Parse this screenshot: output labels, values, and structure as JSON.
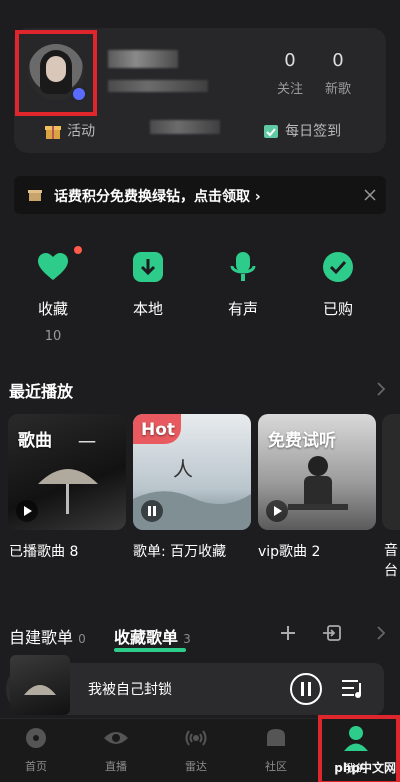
{
  "profile": {
    "stats": [
      {
        "value": "0",
        "label": "关注"
      },
      {
        "value": "0",
        "label": "新歌"
      }
    ],
    "activity_label": "活动",
    "checkin_label": "每日签到"
  },
  "banner": {
    "text": "话费积分免费换绿钻，点击领取 ›"
  },
  "quick_actions": [
    {
      "label": "收藏",
      "count": "10"
    },
    {
      "label": "本地",
      "count": ""
    },
    {
      "label": "有声",
      "count": ""
    },
    {
      "label": "已购",
      "count": ""
    }
  ],
  "recent": {
    "title": "最近播放",
    "cards": [
      {
        "tag": "歌曲",
        "caption": "已播歌曲 8"
      },
      {
        "tag": "Hot",
        "caption": "歌单: 百万收藏"
      },
      {
        "tag": "免费试听",
        "caption": "vip歌曲 2"
      },
      {
        "tag": "",
        "caption": "音台"
      }
    ]
  },
  "playlist_tabs": [
    {
      "label": "自建歌单",
      "count": "0"
    },
    {
      "label": "收藏歌单",
      "count": "3"
    }
  ],
  "player": {
    "song": "我被自己封锁"
  },
  "nav": [
    {
      "label": "首页",
      "icon": "music-disc-icon"
    },
    {
      "label": "直播",
      "icon": "eye-icon"
    },
    {
      "label": "雷达",
      "icon": "radar-icon"
    },
    {
      "label": "社区",
      "icon": "community-icon"
    },
    {
      "label": "我的",
      "icon": "user-icon"
    }
  ],
  "watermark": "php中文网",
  "colors": {
    "accent": "#2ecc8a",
    "highlight_box": "#e0262d",
    "background": "#1d1d1f"
  }
}
